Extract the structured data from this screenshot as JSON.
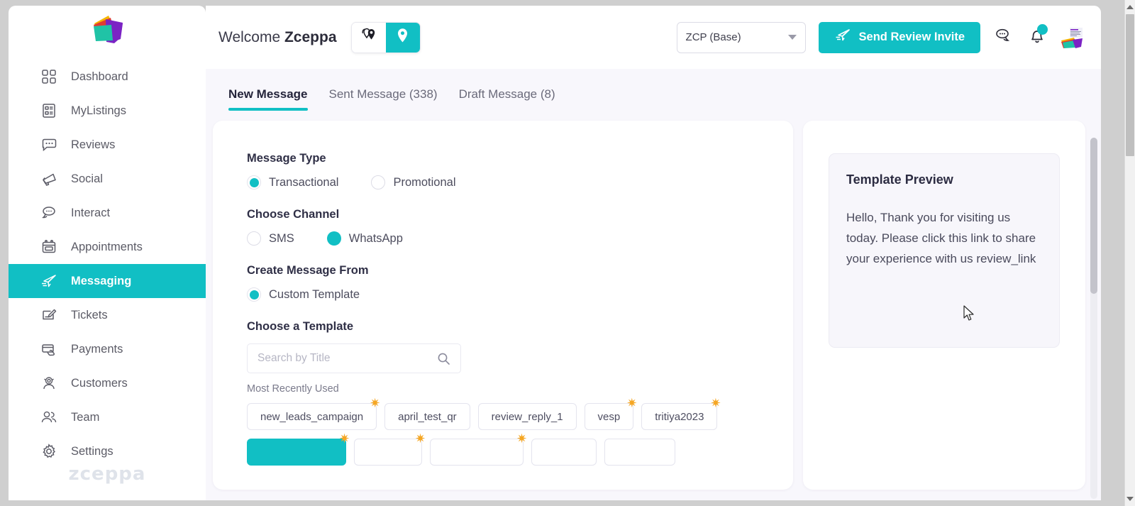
{
  "brand": {
    "name": "zceppa",
    "logo_icon": "zceppa-logo",
    "accent_color": "#11bfc4",
    "page_bg": "#f8f7fc"
  },
  "sidebar": {
    "wordmark": "zceppa",
    "items": [
      {
        "label": "Dashboard",
        "icon": "grid-icon",
        "active": false
      },
      {
        "label": "MyListings",
        "icon": "list-card-icon",
        "active": false
      },
      {
        "label": "Reviews",
        "icon": "chat-review-icon",
        "active": false
      },
      {
        "label": "Social",
        "icon": "megaphone-icon",
        "active": false
      },
      {
        "label": "Interact",
        "icon": "chat-bubbles-icon",
        "active": false
      },
      {
        "label": "Appointments",
        "icon": "calendar-icon",
        "active": false
      },
      {
        "label": "Messaging",
        "icon": "paper-plane-icon",
        "active": true
      },
      {
        "label": "Tickets",
        "icon": "ticket-edit-icon",
        "active": false
      },
      {
        "label": "Payments",
        "icon": "credit-card-icon",
        "active": false
      },
      {
        "label": "Customers",
        "icon": "customer-icon",
        "active": false
      },
      {
        "label": "Team",
        "icon": "team-icon",
        "active": false
      },
      {
        "label": "Settings",
        "icon": "gear-icon",
        "active": false
      }
    ]
  },
  "topbar": {
    "welcome_prefix": "Welcome",
    "welcome_name": "Zceppa",
    "pin_toggle": {
      "multi_location_icon": "multi-location-pin-icon",
      "single_location_icon": "location-pin-icon",
      "selected": "single"
    },
    "location_select": {
      "value": "ZCP (Base)",
      "caret_icon": "chevron-down-icon"
    },
    "invite_button": {
      "label": "Send Review Invite",
      "icon": "paper-plane-icon"
    },
    "chat_icon": "chat-bubbles-icon",
    "notification_icon": "bell-icon",
    "notification_badge": true,
    "avatar": "user-avatar"
  },
  "tabs": [
    {
      "label": "New Message",
      "active": true
    },
    {
      "label": "Sent Message (338)",
      "active": false
    },
    {
      "label": "Draft Message (8)",
      "active": false
    }
  ],
  "form": {
    "message_type": {
      "label": "Message Type",
      "options": [
        {
          "label": "Transactional",
          "selected": true,
          "style": "ring"
        },
        {
          "label": "Promotional",
          "selected": false,
          "style": "empty"
        }
      ]
    },
    "channel": {
      "label": "Choose Channel",
      "options": [
        {
          "label": "SMS",
          "selected": false,
          "style": "empty"
        },
        {
          "label": "WhatsApp",
          "selected": true,
          "style": "solid"
        }
      ]
    },
    "create_from": {
      "label": "Create Message From",
      "options": [
        {
          "label": "Custom Template",
          "selected": true,
          "style": "ring"
        }
      ]
    },
    "choose_template": {
      "label": "Choose a Template",
      "search": {
        "placeholder": "Search by Title",
        "value": "",
        "icon": "search-icon"
      },
      "mru_label": "Most Recently Used",
      "chips": [
        {
          "label": "new_leads_campaign",
          "starred": true,
          "selected": false
        },
        {
          "label": "april_test_qr",
          "starred": false,
          "selected": false
        },
        {
          "label": "review_reply_1",
          "starred": false,
          "selected": false
        },
        {
          "label": "vesp",
          "starred": true,
          "selected": false
        },
        {
          "label": "tritiya2023",
          "starred": true,
          "selected": false
        },
        {
          "label": "",
          "starred": true,
          "selected": true
        },
        {
          "label": "",
          "starred": true,
          "selected": false
        },
        {
          "label": "",
          "starred": true,
          "selected": false
        },
        {
          "label": "",
          "starred": false,
          "selected": false
        },
        {
          "label": "",
          "starred": false,
          "selected": false
        }
      ]
    }
  },
  "preview": {
    "title": "Template Preview",
    "body": "Hello, Thank you for visiting us today. Please click this link to share your experience with us review_link"
  }
}
